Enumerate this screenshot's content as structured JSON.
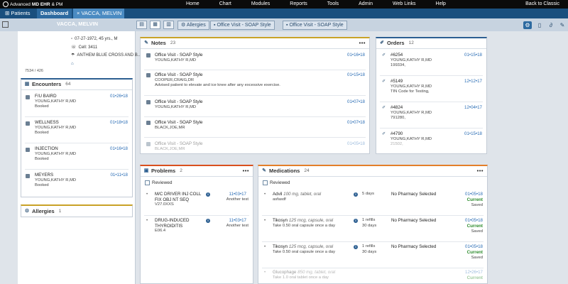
{
  "app": {
    "brand_prefix": "Advanced",
    "brand_main": "MD EHR",
    "brand_suffix": "& PM",
    "back_label": "Back to Classic"
  },
  "menu": [
    "Home",
    "Chart",
    "Modules",
    "Reports",
    "Tools",
    "Admin",
    "Web Links",
    "Help"
  ],
  "tabs": {
    "patients": "Patients",
    "dashboard": "Dashboard",
    "patient_tab": "VACCA, MELVIN",
    "close": "×"
  },
  "patient": {
    "name": "VACCA, MELVIN",
    "dob": "07-27-1972, 45 yrs., M",
    "cell": "Cell: 3411",
    "insurance": "ANTHEM BLUE CROSS AND B...",
    "account": "7534 / 426"
  },
  "toolbar": {
    "allergies_tab": "Allergies",
    "visit_tab_1": "Office Visit - SOAP Style",
    "visit_tab_2": "Office Visit - SOAP Style"
  },
  "encounters": {
    "title": "Encounters",
    "count": "64",
    "items": [
      {
        "title": "F/U BAIRD",
        "provider": "YOUNG,KATHY R,MD",
        "status": "Booked",
        "date": "01•26•18"
      },
      {
        "title": "WELLNESS",
        "provider": "YOUNG,KATHY R,MD",
        "status": "Booked",
        "date": "01•18•18"
      },
      {
        "title": "INJECTION",
        "provider": "YOUNG,KATHY R,MD",
        "status": "Booked",
        "date": "01•16•18"
      },
      {
        "title": "MEYERS",
        "provider": "YOUNG,KATHY R,MD",
        "status": "Booked",
        "date": "01•11•18"
      }
    ]
  },
  "allergies": {
    "title": "Allergies",
    "count": "1"
  },
  "notes": {
    "title": "Notes",
    "count": "23",
    "items": [
      {
        "title": "Office Visit - SOAP Style",
        "line1": "YOUNG,KATHY R,MD",
        "line2": "",
        "date": "01•16•18"
      },
      {
        "title": "Office Visit - SOAP Style",
        "line1": "COOPER,CRAIG,DR",
        "line2": "Advised patient to elevate and ice knee after any excessive exercise.",
        "date": "01•15•18"
      },
      {
        "title": "Office Visit - SOAP Style",
        "line1": "YOUNG,KATHY R,MD",
        "line2": "",
        "date": "01•07•18"
      },
      {
        "title": "Office Visit - SOAP Style",
        "line1": "BLACK,JOE,MR",
        "line2": "",
        "date": "01•07•18"
      },
      {
        "title": "Office Visit - SOAP Style",
        "line1": "BLACK,JOE,MR",
        "line2": "",
        "date": "01•05•18"
      }
    ]
  },
  "orders": {
    "title": "Orders",
    "count": "12",
    "items": [
      {
        "id": "#6254",
        "provider": "YOUNG,KATHY R,MD",
        "detail": "199334,",
        "date": "01•15•18"
      },
      {
        "id": "#5149",
        "provider": "YOUNG,KATHY R,MD",
        "detail": "TIN Code for Testing,",
        "date": "12•12•17"
      },
      {
        "id": "#4824",
        "provider": "YOUNG,KATHY R,MD",
        "detail": "791280,",
        "date": "12•04•17"
      },
      {
        "id": "#4790",
        "provider": "YOUNG,KATHY R,MD",
        "detail": "21502,",
        "date": "01•15•18"
      }
    ]
  },
  "problems": {
    "title": "Problems",
    "count": "2",
    "reviewed": "Reviewed",
    "items": [
      {
        "name1": "M/C DRIVER INJ COLL",
        "name2": "FIX OBJ NT SEQ",
        "code": "V27.0XXS",
        "date": "11•03•17",
        "source": "Another test"
      },
      {
        "name1": "DRUG-INDUCED",
        "name2": "THYROIDITIS",
        "code": "E06.4",
        "date": "11•03•17",
        "source": "Another test"
      }
    ]
  },
  "medications": {
    "title": "Medications",
    "count": "24",
    "reviewed": "Reviewed",
    "items": [
      {
        "name": "Advil",
        "dose": "100 mg, tablet, oral",
        "sig": "asfasdf",
        "qty1": "5 days",
        "qty2": "",
        "pharmacy": "No Pharmacy Selected",
        "date": "01•05•18",
        "status1": "Current",
        "status2": "Saved"
      },
      {
        "name": "Tikosyn",
        "dose": "125 mcg, capsule, oral",
        "sig": "Take 0.50 oral capsule once a day",
        "qty1": "1 refills",
        "qty2": "30 days",
        "pharmacy": "No Pharmacy Selected",
        "date": "01•05•18",
        "status1": "Current",
        "status2": "Saved"
      },
      {
        "name": "Tikosyn",
        "dose": "125 mcg, capsule, oral",
        "sig": "Take 0.50 oral capsule once a day",
        "qty1": "1 refills",
        "qty2": "30 days",
        "pharmacy": "No Pharmacy Selected",
        "date": "01•05•18",
        "status1": "Current",
        "status2": "Saved"
      },
      {
        "name": "Glucophage",
        "dose": "850 mg, tablet, oral",
        "sig": "Take 1.0 oral tablet once a day",
        "qty1": "",
        "qty2": "",
        "pharmacy": "",
        "date": "12•26•17",
        "status1": "Current",
        "status2": ""
      }
    ]
  },
  "colors": {
    "topbar": "#0b0b0b",
    "tabbar": "#1a4f7e",
    "accent_blue": "#2a6db5",
    "current_green": "#2a8a2a",
    "encounters_bar": "#2d5f91",
    "notes_bar": "#c9a227",
    "orders_bar": "#2d5f91",
    "problems_bar": "#d9501e",
    "medications_bar": "#e37f2a",
    "allergies_bar": "#c9a227"
  }
}
